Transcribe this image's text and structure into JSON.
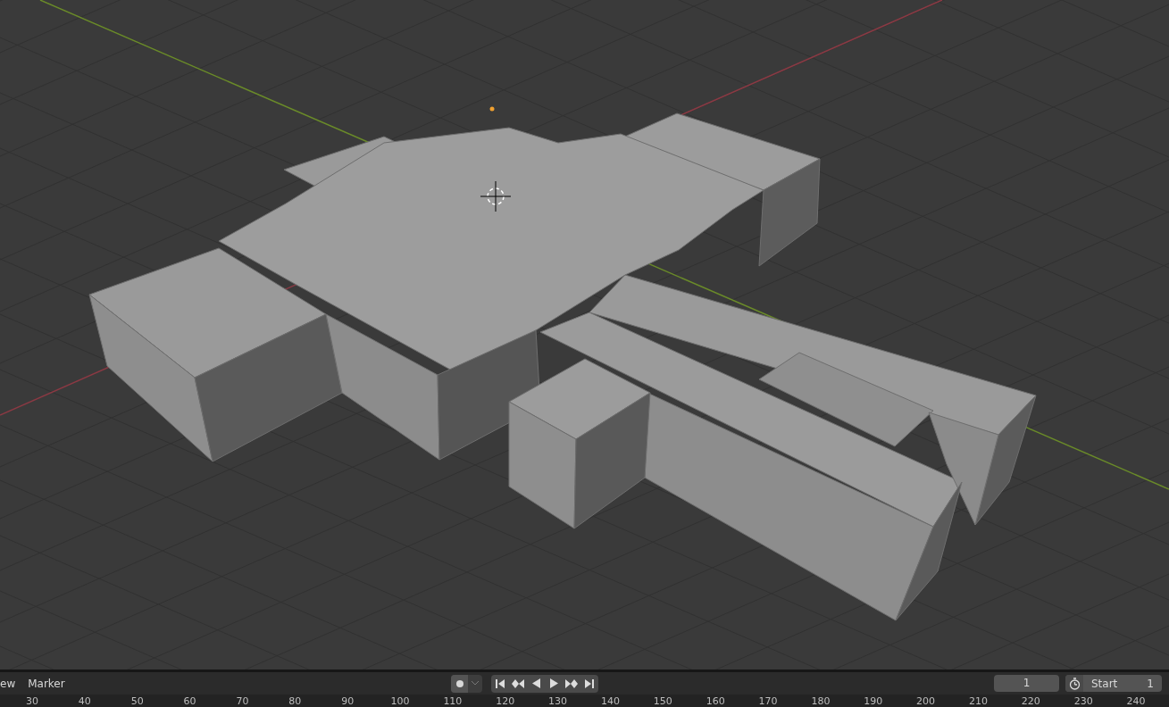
{
  "timeline": {
    "menus": [
      {
        "label": "ew"
      },
      {
        "label": "Marker"
      }
    ],
    "current_frame": "1",
    "start": {
      "label": "Start",
      "value": "1"
    },
    "ruler_ticks": [
      "30",
      "40",
      "50",
      "60",
      "70",
      "80",
      "90",
      "100",
      "110",
      "120",
      "130",
      "140",
      "150",
      "160",
      "170",
      "180",
      "190",
      "200",
      "210",
      "220",
      "230",
      "240"
    ]
  }
}
